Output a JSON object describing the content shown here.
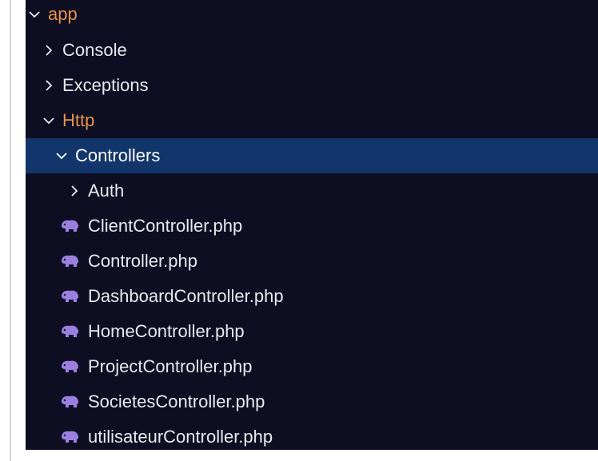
{
  "explorer": {
    "root": {
      "label": "app",
      "expanded": true
    },
    "folders": [
      {
        "label": "Console",
        "expanded": false
      },
      {
        "label": "Exceptions",
        "expanded": false
      },
      {
        "label": "Http",
        "expanded": true
      }
    ],
    "controllers": {
      "label": "Controllers",
      "expanded": true,
      "selected": true
    },
    "auth": {
      "label": "Auth",
      "expanded": false
    },
    "files": [
      {
        "label": "ClientController.php",
        "icon": "php-elephant-icon"
      },
      {
        "label": "Controller.php",
        "icon": "php-elephant-icon"
      },
      {
        "label": "DashboardController.php",
        "icon": "php-elephant-icon"
      },
      {
        "label": "HomeController.php",
        "icon": "php-elephant-icon"
      },
      {
        "label": "ProjectController.php",
        "icon": "php-elephant-icon"
      },
      {
        "label": "SocietesController.php",
        "icon": "php-elephant-icon"
      },
      {
        "label": "utilisateurController.php",
        "icon": "php-elephant-icon"
      }
    ],
    "colors": {
      "background": "#0e0e22",
      "selection": "#12356b",
      "folder_open_text": "#e8914a",
      "text": "#e9e9ee",
      "php_icon": "#9b7fe0"
    }
  }
}
